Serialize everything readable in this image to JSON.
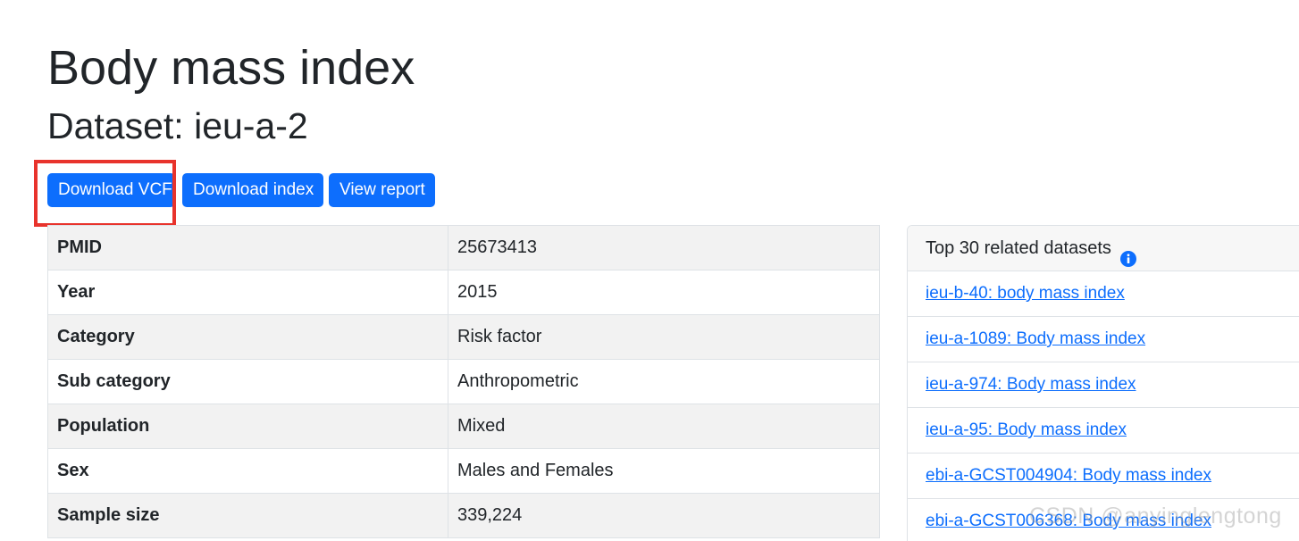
{
  "header": {
    "title": "Body mass index",
    "subtitle": "Dataset: ieu-a-2"
  },
  "buttons": {
    "download_vcf": "Download VCF",
    "download_index": "Download index",
    "view_report": "View report"
  },
  "metadata": {
    "rows": [
      {
        "key": "PMID",
        "value": "25673413"
      },
      {
        "key": "Year",
        "value": "2015"
      },
      {
        "key": "Category",
        "value": "Risk factor"
      },
      {
        "key": "Sub category",
        "value": "Anthropometric"
      },
      {
        "key": "Population",
        "value": "Mixed"
      },
      {
        "key": "Sex",
        "value": "Males and Females"
      },
      {
        "key": "Sample size",
        "value": "339,224"
      }
    ]
  },
  "related": {
    "title": "Top 30 related datasets",
    "icon": "info-circle-icon",
    "items": [
      "ieu-b-40: body mass index",
      "ieu-a-1089: Body mass index",
      "ieu-a-974: Body mass index",
      "ieu-a-95: Body mass index",
      "ebi-a-GCST004904: Body mass index",
      "ebi-a-GCST006368: Body mass index"
    ]
  },
  "watermark": "CSDN @anyinglengtong",
  "colors": {
    "primary": "#0d6efd",
    "highlight": "#e8332c",
    "stripe": "#f2f2f2",
    "border": "#dee2e6"
  }
}
